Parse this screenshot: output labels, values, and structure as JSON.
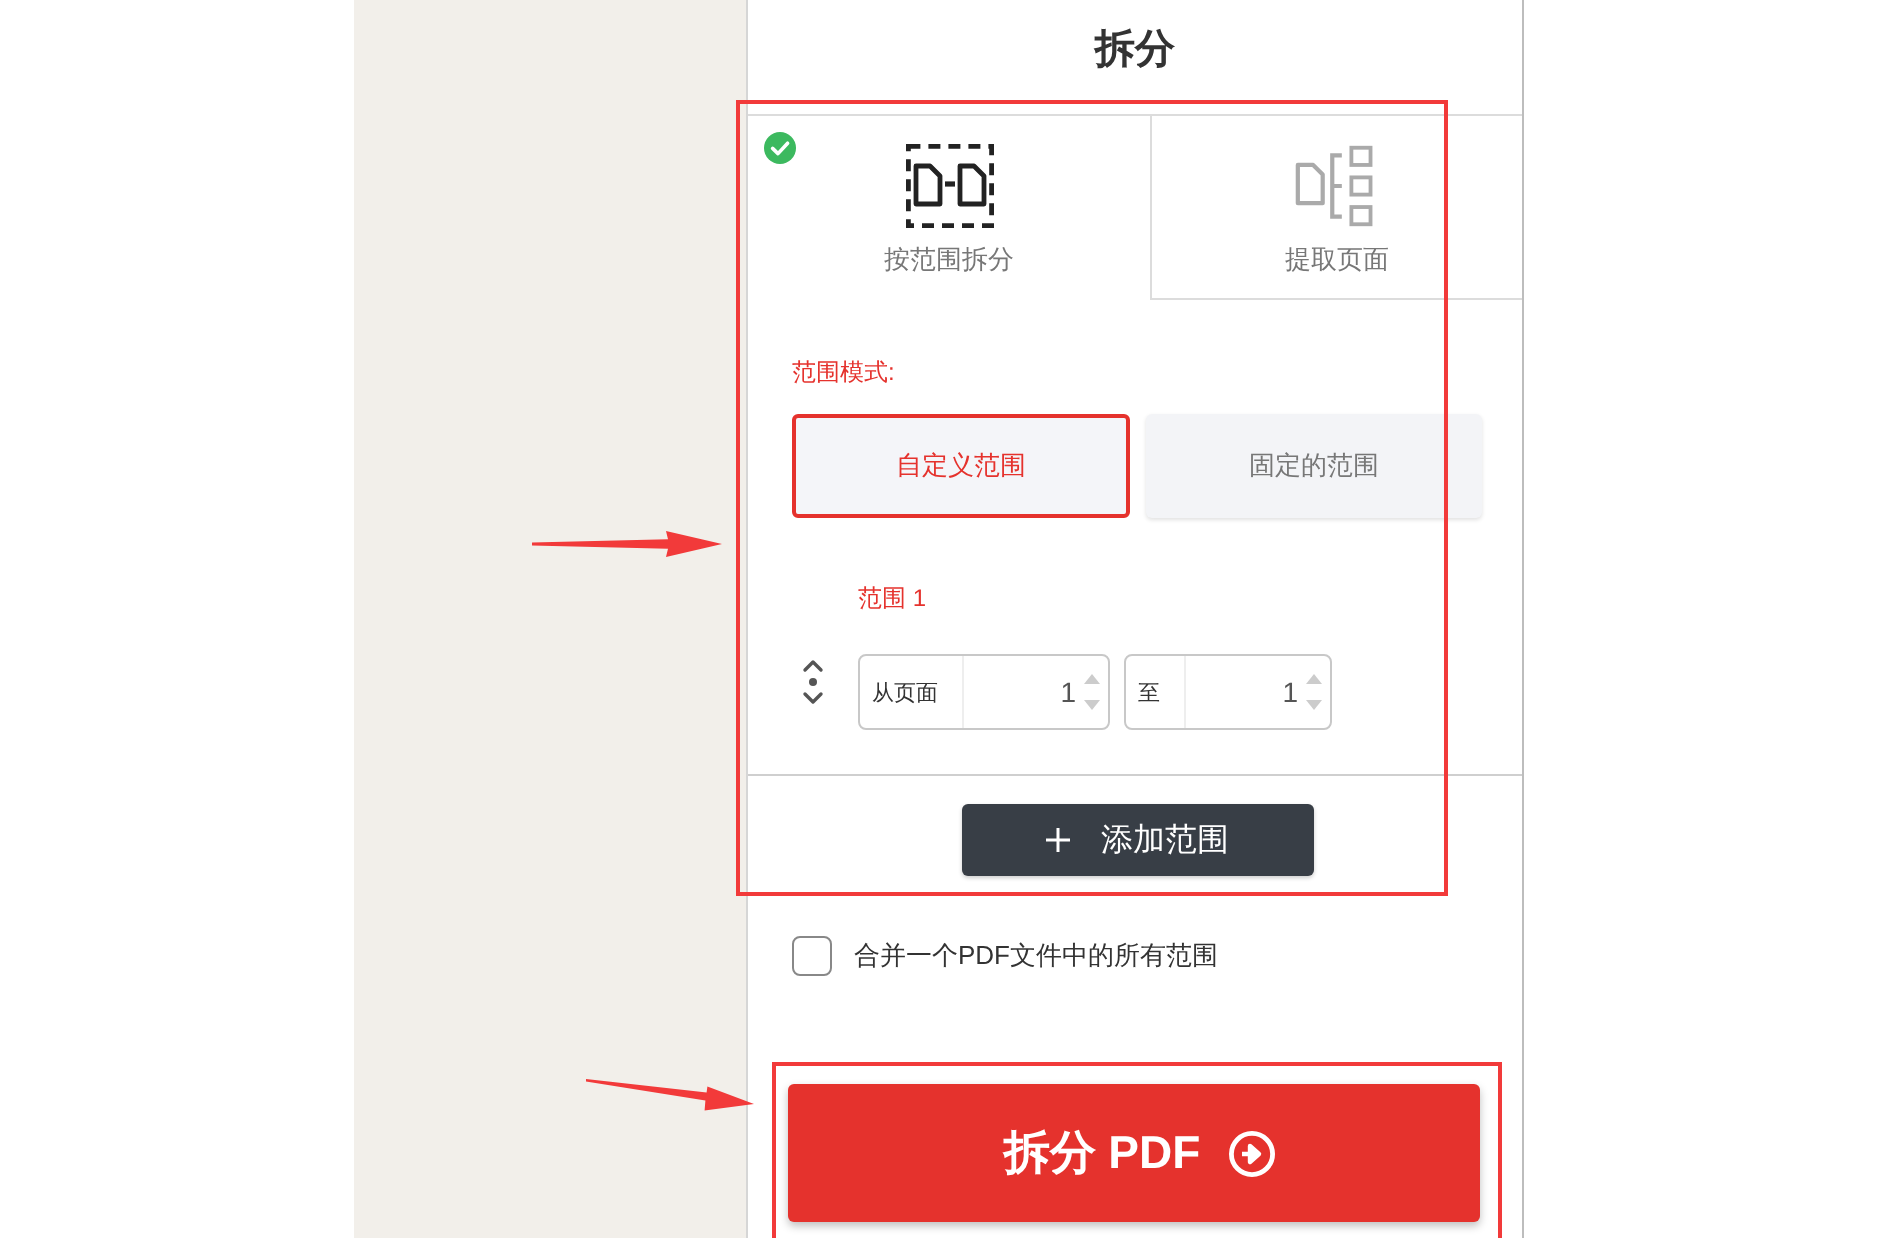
{
  "title": "拆分",
  "options_section": {
    "highlighted": true,
    "tabs": [
      {
        "kind": "split-range",
        "label": "按范围拆分",
        "selected": true
      },
      {
        "kind": "extract-pages",
        "label": "提取页面",
        "selected": false
      }
    ],
    "range_mode": {
      "label": "范围模式:",
      "options": [
        {
          "label": "自定义范围",
          "selected": true
        },
        {
          "label": "固定的范围",
          "selected": false
        }
      ]
    },
    "ranges": [
      {
        "label": "范围 1",
        "from": {
          "label": "从页面",
          "value": "1"
        },
        "to": {
          "label": "至",
          "value": "1"
        }
      }
    ],
    "add_button": {
      "label": "添加范围"
    }
  },
  "merge_option": {
    "label": "合并一个PDF文件中的所有范围",
    "checked": false
  },
  "submit_section": {
    "highlighted": true,
    "button": {
      "label": "拆分 PDF"
    }
  }
}
